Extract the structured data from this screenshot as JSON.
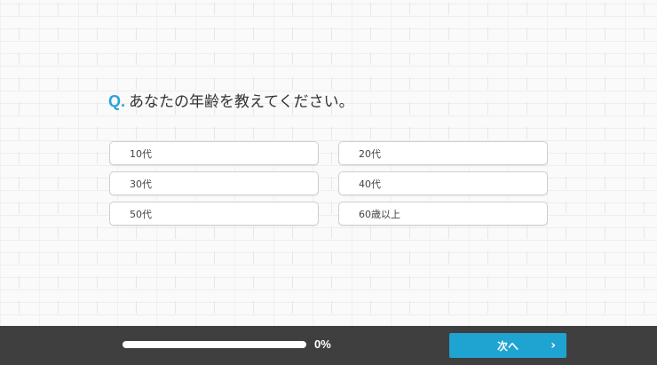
{
  "question": {
    "prefix": "Q.",
    "text": "あなたの年齢を教えてください。"
  },
  "options": [
    {
      "label": "10代"
    },
    {
      "label": "20代"
    },
    {
      "label": "30代"
    },
    {
      "label": "40代"
    },
    {
      "label": "50代"
    },
    {
      "label": "60歳以上"
    }
  ],
  "footer": {
    "progress_fraction": 0,
    "progress_label": "0%",
    "next_label": "次へ",
    "next_icon": "chevron-right-icon"
  },
  "colors": {
    "accent": "#2ba3d9",
    "button": "#1fa3d0",
    "footer_bg": "#3f3f3f"
  }
}
